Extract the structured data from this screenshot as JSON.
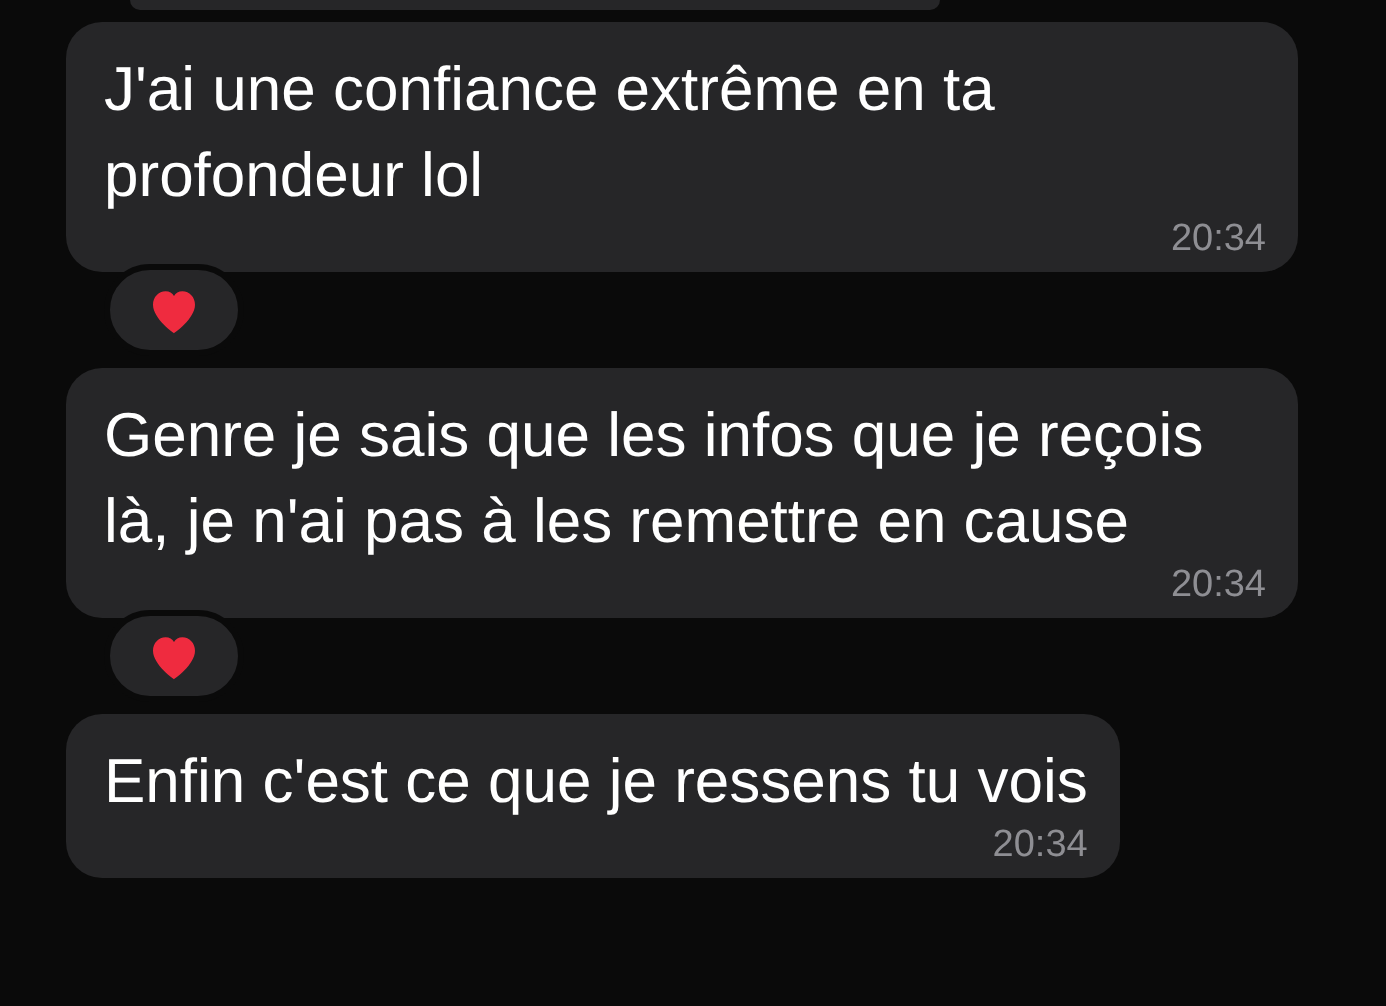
{
  "messages": [
    {
      "text": "J'ai une confiance extrême en ta profondeur lol",
      "time": "20:34",
      "reacted": true
    },
    {
      "text": "Genre je sais que les infos que je reçois là, je n'ai pas à les remettre en cause",
      "time": "20:34",
      "reacted": true
    },
    {
      "text": "Enfin c'est ce que je ressens tu vois",
      "time": "20:34",
      "reacted": false
    }
  ]
}
